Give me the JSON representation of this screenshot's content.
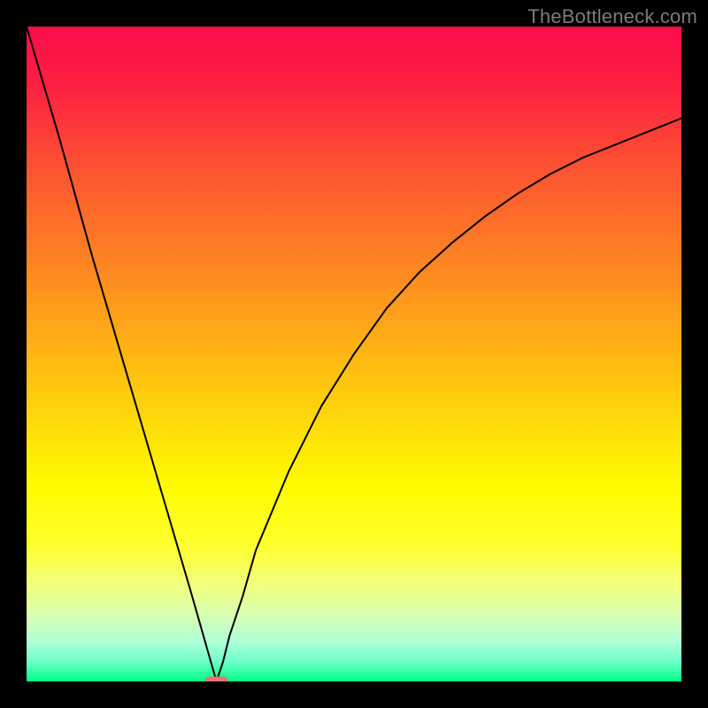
{
  "watermark": "TheBottleneck.com",
  "chart_data": {
    "type": "line",
    "title": "",
    "xlabel": "",
    "ylabel": "",
    "xlim": [
      0,
      100
    ],
    "ylim": [
      0,
      100
    ],
    "optimum_x": 29,
    "series": [
      {
        "name": "bottleneck-curve",
        "x": [
          0,
          5,
          10,
          15,
          20,
          25,
          27,
          28,
          29,
          30,
          31,
          33,
          35,
          40,
          45,
          50,
          55,
          60,
          65,
          70,
          75,
          80,
          85,
          90,
          95,
          100
        ],
        "y": [
          100,
          83,
          65,
          48,
          31,
          14,
          7,
          3.5,
          0,
          3,
          7,
          13,
          20,
          32,
          42,
          50,
          57,
          62.5,
          67,
          71,
          74.5,
          77.5,
          80,
          82,
          84,
          86
        ]
      }
    ],
    "marker": {
      "name": "optimum-marker",
      "x": 29,
      "y": 0,
      "width_pct": 3.4,
      "height_pct": 1.2,
      "color": "#e77471"
    },
    "gradient_stops": [
      {
        "pct": 0,
        "color": "#fc0c4a"
      },
      {
        "pct": 9,
        "color": "#fd2041"
      },
      {
        "pct": 22,
        "color": "#fd5431"
      },
      {
        "pct": 40,
        "color": "#fe921e"
      },
      {
        "pct": 56,
        "color": "#fecb0d"
      },
      {
        "pct": 70,
        "color": "#fefb00"
      },
      {
        "pct": 79,
        "color": "#feff2a"
      },
      {
        "pct": 85,
        "color": "#f2ff79"
      },
      {
        "pct": 90,
        "color": "#d7ffb4"
      },
      {
        "pct": 94,
        "color": "#aeffd8"
      },
      {
        "pct": 97,
        "color": "#6dffc9"
      },
      {
        "pct": 100,
        "color": "#00ff83"
      }
    ]
  }
}
